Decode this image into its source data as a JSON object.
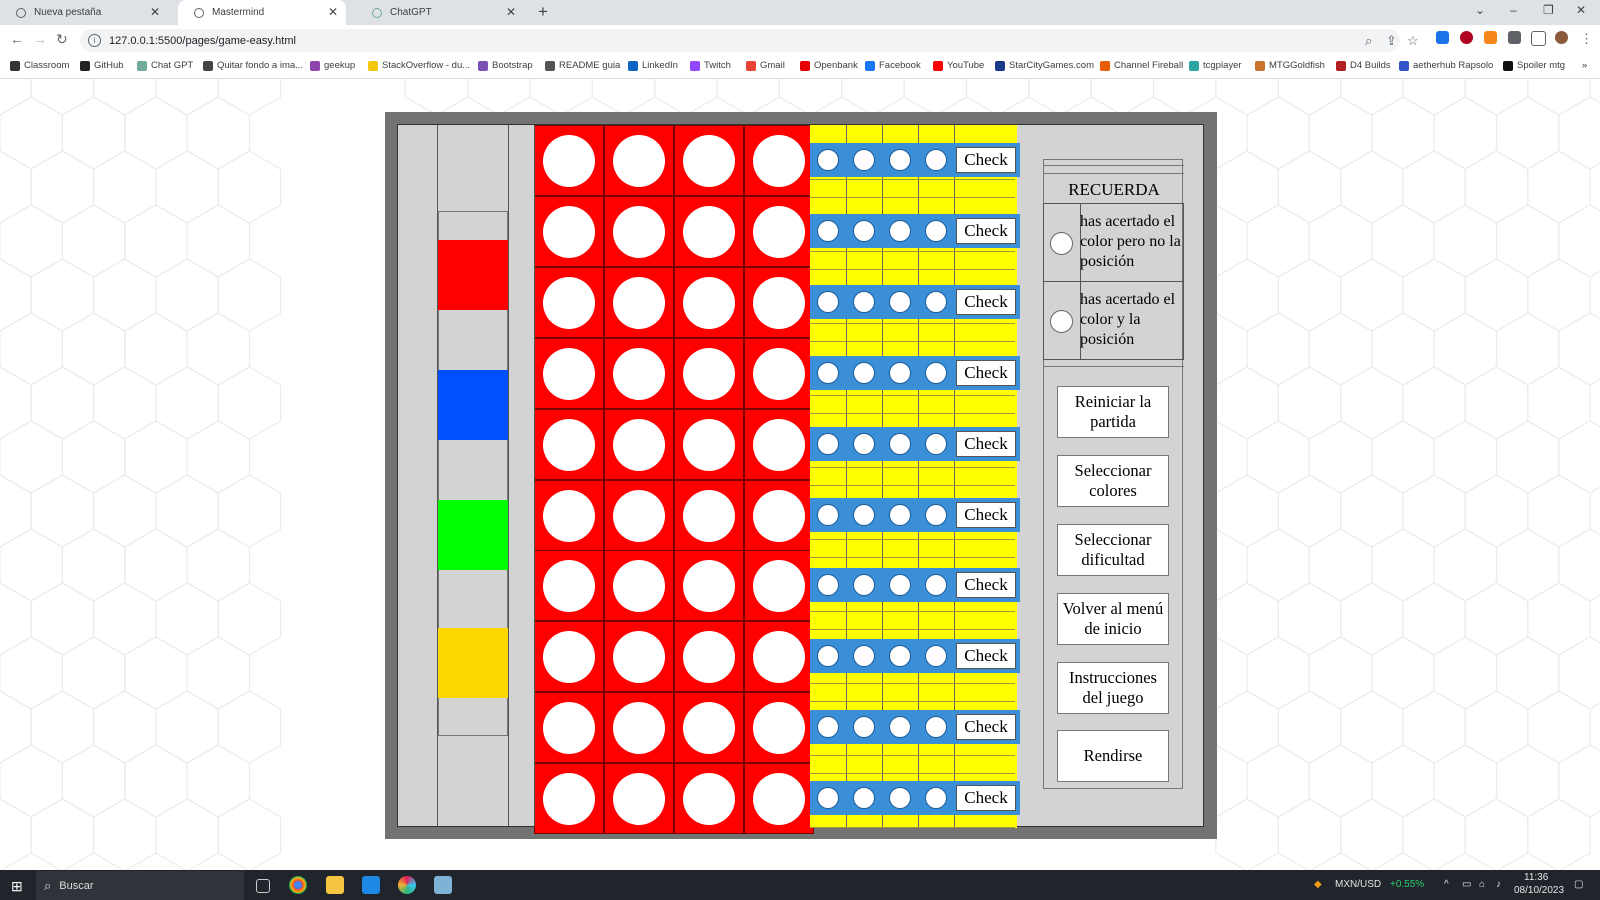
{
  "browser": {
    "tabs": [
      {
        "label": "Nueva pestaña",
        "active": false
      },
      {
        "label": "Mastermind",
        "active": true
      },
      {
        "label": "ChatGPT",
        "active": false
      }
    ],
    "url": "127.0.0.1:5500/pages/game-easy.html",
    "bookmarks": [
      {
        "label": "Classroom",
        "color": "#333333"
      },
      {
        "label": "GitHub",
        "color": "#222222"
      },
      {
        "label": "Chat GPT",
        "color": "#74aa9c"
      },
      {
        "label": "Quitar fondo a ima...",
        "color": "#444444"
      },
      {
        "label": "geekup",
        "color": "#8e44ad"
      },
      {
        "label": "StackOverflow - du...",
        "color": "#f2c811"
      },
      {
        "label": "Bootstrap",
        "color": "#7952b3"
      },
      {
        "label": "README guia",
        "color": "#555555"
      },
      {
        "label": "LinkedIn",
        "color": "#0a66c2"
      },
      {
        "label": "Twitch",
        "color": "#9146ff"
      },
      {
        "label": "Gmail",
        "color": "#ea4335"
      },
      {
        "label": "Openbank",
        "color": "#e60000"
      },
      {
        "label": "Facebook",
        "color": "#1877f2"
      },
      {
        "label": "YouTube",
        "color": "#ff0000"
      },
      {
        "label": "StarCityGames.com",
        "color": "#1a3a8a"
      },
      {
        "label": "Channel Fireball",
        "color": "#e85d04"
      },
      {
        "label": "tcgplayer",
        "color": "#2aa5a0"
      },
      {
        "label": "MTGGoldfish",
        "color": "#c8742c"
      },
      {
        "label": "D4 Builds",
        "color": "#b22222"
      },
      {
        "label": "aetherhub Rapsolo",
        "color": "#3355cc"
      },
      {
        "label": "Spoiler mtg",
        "color": "#111111"
      }
    ]
  },
  "game": {
    "palette": [
      {
        "name": "red",
        "color": "#ff0000"
      },
      {
        "name": "blue",
        "color": "#0050ff"
      },
      {
        "name": "green",
        "color": "#00ff00"
      },
      {
        "name": "yellow",
        "color": "#ffd700"
      }
    ],
    "rows": [
      {
        "check_label": "Check"
      },
      {
        "check_label": "Check"
      },
      {
        "check_label": "Check"
      },
      {
        "check_label": "Check"
      },
      {
        "check_label": "Check"
      },
      {
        "check_label": "Check"
      },
      {
        "check_label": "Check"
      },
      {
        "check_label": "Check"
      },
      {
        "check_label": "Check"
      },
      {
        "check_label": "Check"
      }
    ],
    "recuerda": {
      "title": "RECUERDA",
      "items": [
        {
          "text": "has acertado el color pero no la posición"
        },
        {
          "text": "has acertado el color y la posición"
        }
      ]
    },
    "buttons": {
      "restart": "Reiniciar la partida",
      "select_colors": "Seleccionar colores",
      "select_difficulty": "Seleccionar dificultad",
      "main_menu": "Volver al menú de inicio",
      "instructions": "Instrucciones del juego",
      "surrender": "Rendirse"
    }
  },
  "taskbar": {
    "search_placeholder": "Buscar",
    "currency": "MXN/USD",
    "currency_change": "+0.55%",
    "time": "11:36",
    "date": "08/10/2023"
  }
}
